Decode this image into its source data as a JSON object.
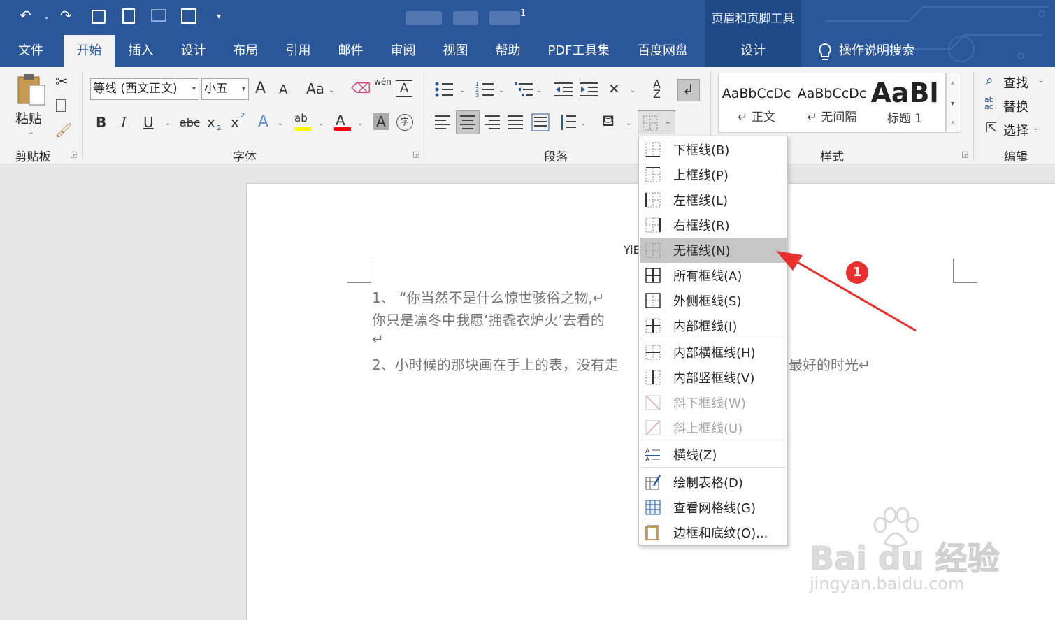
{
  "titlebar": {
    "context_tool_title": "页眉和页脚工具",
    "qat_indicator": "1"
  },
  "tabs": [
    {
      "label": "文件"
    },
    {
      "label": "开始"
    },
    {
      "label": "插入"
    },
    {
      "label": "设计"
    },
    {
      "label": "布局"
    },
    {
      "label": "引用"
    },
    {
      "label": "邮件"
    },
    {
      "label": "审阅"
    },
    {
      "label": "视图"
    },
    {
      "label": "帮助"
    },
    {
      "label": "PDF工具集"
    },
    {
      "label": "百度网盘"
    },
    {
      "label": "设计"
    }
  ],
  "active_tab": "开始",
  "tell_me": "操作说明搜索",
  "ribbon": {
    "clipboard": {
      "paste_label": "粘贴",
      "group_label": "剪贴板"
    },
    "font": {
      "font_name": "等线 (西文正文)",
      "font_size": "小五",
      "group_label": "字体",
      "grow": "A",
      "shrink": "A",
      "change_case": "Aa",
      "pinyin": "wén",
      "bold": "B",
      "italic": "I",
      "underline": "U",
      "strike": "abc",
      "subscript": "x",
      "superscript": "x",
      "highlight": "ab",
      "font_color": "A",
      "char_shading": "A",
      "enclose": "字"
    },
    "paragraph": {
      "group_label": "段落"
    },
    "styles": {
      "group_label": "样式",
      "items": [
        {
          "sample": "AaBbCcDc",
          "name": "↵ 正文"
        },
        {
          "sample": "AaBbCcDc",
          "name": "↵ 无间隔"
        },
        {
          "sample": "AaBl",
          "name": "标题 1"
        }
      ]
    },
    "editing": {
      "find": "查找",
      "replace": "替换",
      "select": "选择",
      "group_label": "编辑"
    }
  },
  "document": {
    "header_fragment": "YiE",
    "lines": [
      "1、 “你当然不是什么惊世骇俗之物,↵",
      "你只是凛冬中我愿‘拥毳衣炉火’去看的",
      "↵",
      "2、小时候的那块画在手上的表，没有走"
    ],
    "line_tail": "最好的时光↵"
  },
  "border_menu": {
    "items": [
      {
        "label": "下框线(B)",
        "icon": "bottom-border-icon",
        "disabled": false
      },
      {
        "label": "上框线(P)",
        "icon": "top-border-icon",
        "disabled": false
      },
      {
        "label": "左框线(L)",
        "icon": "left-border-icon",
        "disabled": false
      },
      {
        "label": "右框线(R)",
        "icon": "right-border-icon",
        "disabled": false
      },
      {
        "label": "无框线(N)",
        "icon": "no-border-icon",
        "disabled": false,
        "highlighted": true
      },
      {
        "label": "所有框线(A)",
        "icon": "all-borders-icon",
        "disabled": false
      },
      {
        "label": "外侧框线(S)",
        "icon": "outside-borders-icon",
        "disabled": false
      },
      {
        "label": "内部框线(I)",
        "icon": "inside-borders-icon",
        "disabled": false
      },
      {
        "label": "内部横框线(H)",
        "icon": "inside-horizontal-border-icon",
        "disabled": false
      },
      {
        "label": "内部竖框线(V)",
        "icon": "inside-vertical-border-icon",
        "disabled": false
      },
      {
        "label": "斜下框线(W)",
        "icon": "diagonal-down-border-icon",
        "disabled": true
      },
      {
        "label": "斜上框线(U)",
        "icon": "diagonal-up-border-icon",
        "disabled": true
      },
      {
        "label": "横线(Z)",
        "icon": "horizontal-line-icon",
        "disabled": false
      },
      {
        "label": "绘制表格(D)",
        "icon": "draw-table-icon",
        "disabled": false
      },
      {
        "label": "查看网格线(G)",
        "icon": "view-gridlines-icon",
        "disabled": false
      },
      {
        "label": "边框和底纹(O)...",
        "icon": "borders-shading-icon",
        "disabled": false
      }
    ]
  },
  "annotation": {
    "badge": "1",
    "color": "#e8312f"
  },
  "watermark": {
    "brand": "Bai du 经验",
    "url": "jingyan.baidu.com"
  },
  "colors": {
    "title_blue": "#2b579a",
    "ribbon_bg": "#f3f3f3",
    "highlight_yellow": "#ffff00",
    "font_red": "#ff0000"
  }
}
